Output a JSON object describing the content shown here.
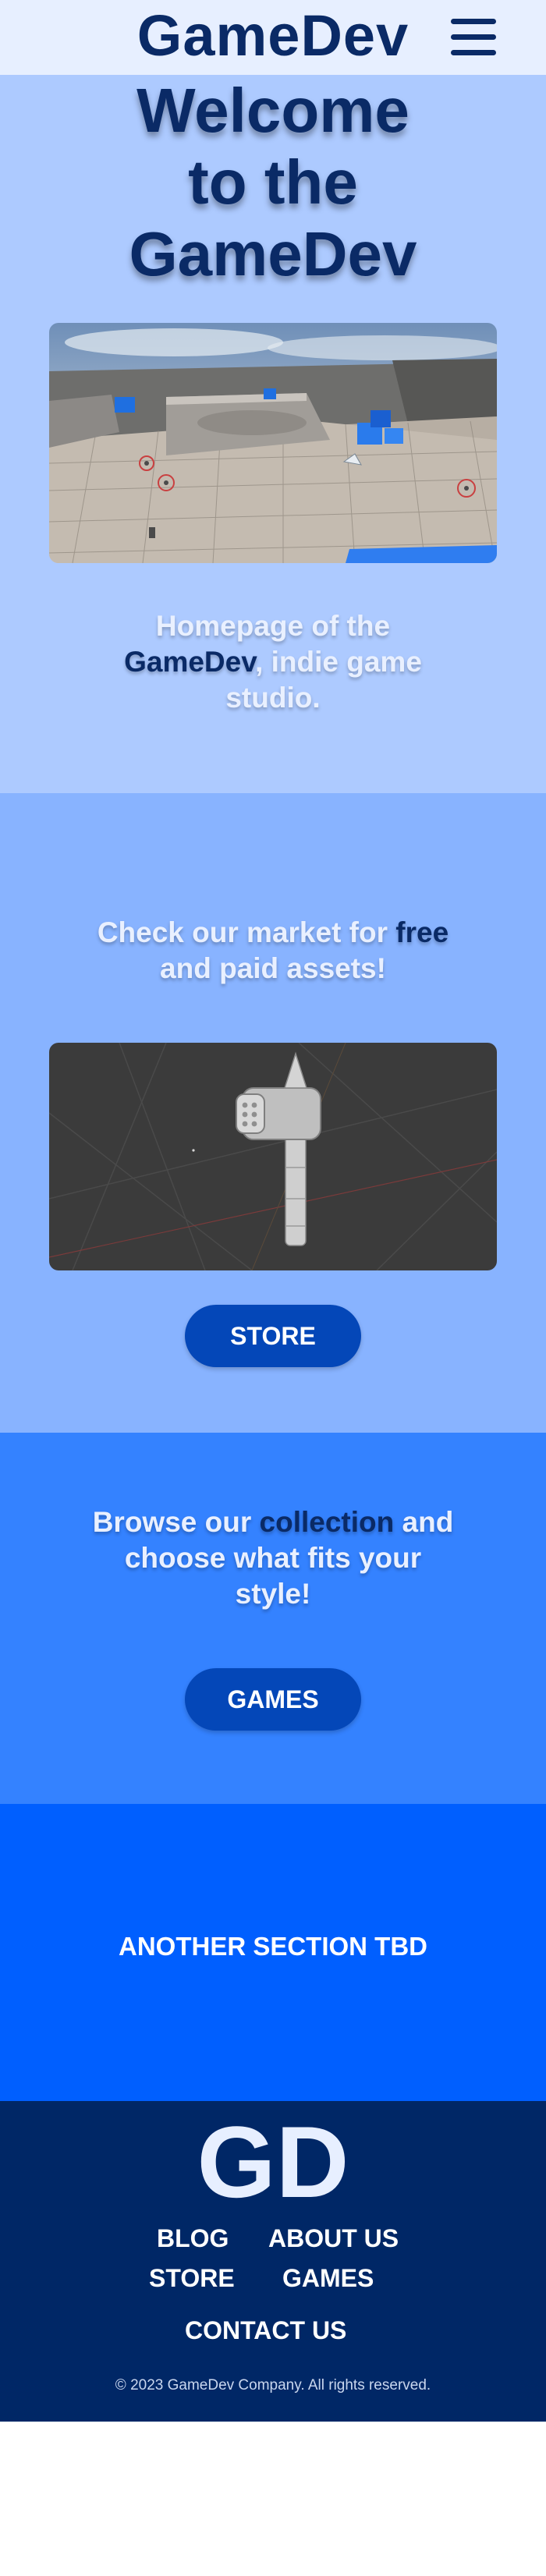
{
  "header": {
    "brand": "GameDev",
    "menu_icon": "hamburger-menu-icon"
  },
  "hero": {
    "title": "Welcome\nto the\nGameDev",
    "lead_part1": "Homepage of the ",
    "lead_highlight": "GameDev",
    "lead_part2": ", indie game studio."
  },
  "market": {
    "lead_part1": "Check our market for ",
    "lead_highlight": "free",
    "lead_part2": " and paid assets!",
    "button_label": "STORE"
  },
  "collection": {
    "lead_part1": "Browse our ",
    "lead_highlight": "collection",
    "lead_part2": " and choose what fits your style!",
    "button_label": "GAMES"
  },
  "tbd": {
    "text": "ANOTHER SECTION TBD"
  },
  "footer": {
    "logo": "GD",
    "links": {
      "blog": "BLOG",
      "about": "ABOUT US",
      "store": "STORE",
      "games": "GAMES",
      "contact": "CONTACT US"
    },
    "copyright": "© 2023 GameDev Company. All rights reserved."
  },
  "colors": {
    "header_bg": "#e7efff",
    "hero_bg": "#adcaff",
    "market_bg": "#88b3ff",
    "collection_bg": "#3482ff",
    "tbd_bg": "#005fff",
    "footer_bg": "#002766",
    "accent_dark": "#0a2a66",
    "button_bg": "#0447b8"
  }
}
